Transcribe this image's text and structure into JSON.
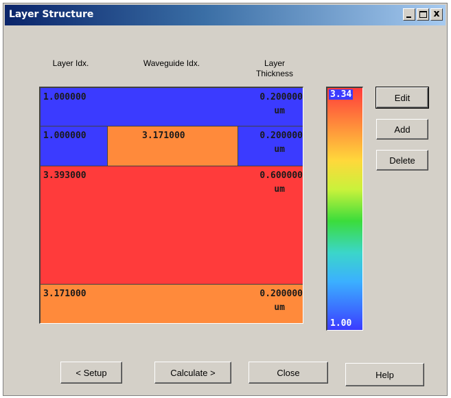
{
  "window": {
    "title": "Layer Structure",
    "close_glyph": "x"
  },
  "headers": {
    "layer_idx": "Layer Idx.",
    "waveguide_idx": "Waveguide Idx.",
    "thickness_line1": "Layer",
    "thickness_line2": "Thickness"
  },
  "layers": [
    {
      "index": "1.000000",
      "thickness": "0.200000",
      "unit": "um",
      "color": "#3b3bff"
    },
    {
      "index": "1.000000",
      "waveguide": "3.171000",
      "waveguide_color": "#ff8a3b",
      "thickness": "0.200000",
      "unit": "um",
      "color": "#3b3bff"
    },
    {
      "index": "3.393000",
      "thickness": "0.600000",
      "unit": "um",
      "color": "#ff3b3b"
    },
    {
      "index": "3.171000",
      "thickness": "0.200000",
      "unit": "um",
      "color": "#ff8a3b"
    }
  ],
  "colorbar": {
    "max": "3.34",
    "min": "1.00"
  },
  "side_buttons": {
    "edit": "Edit",
    "add": "Add",
    "delete": "Delete"
  },
  "footer_buttons": {
    "setup": "< Setup",
    "calculate": "Calculate >",
    "close": "Close",
    "help": "Help"
  }
}
